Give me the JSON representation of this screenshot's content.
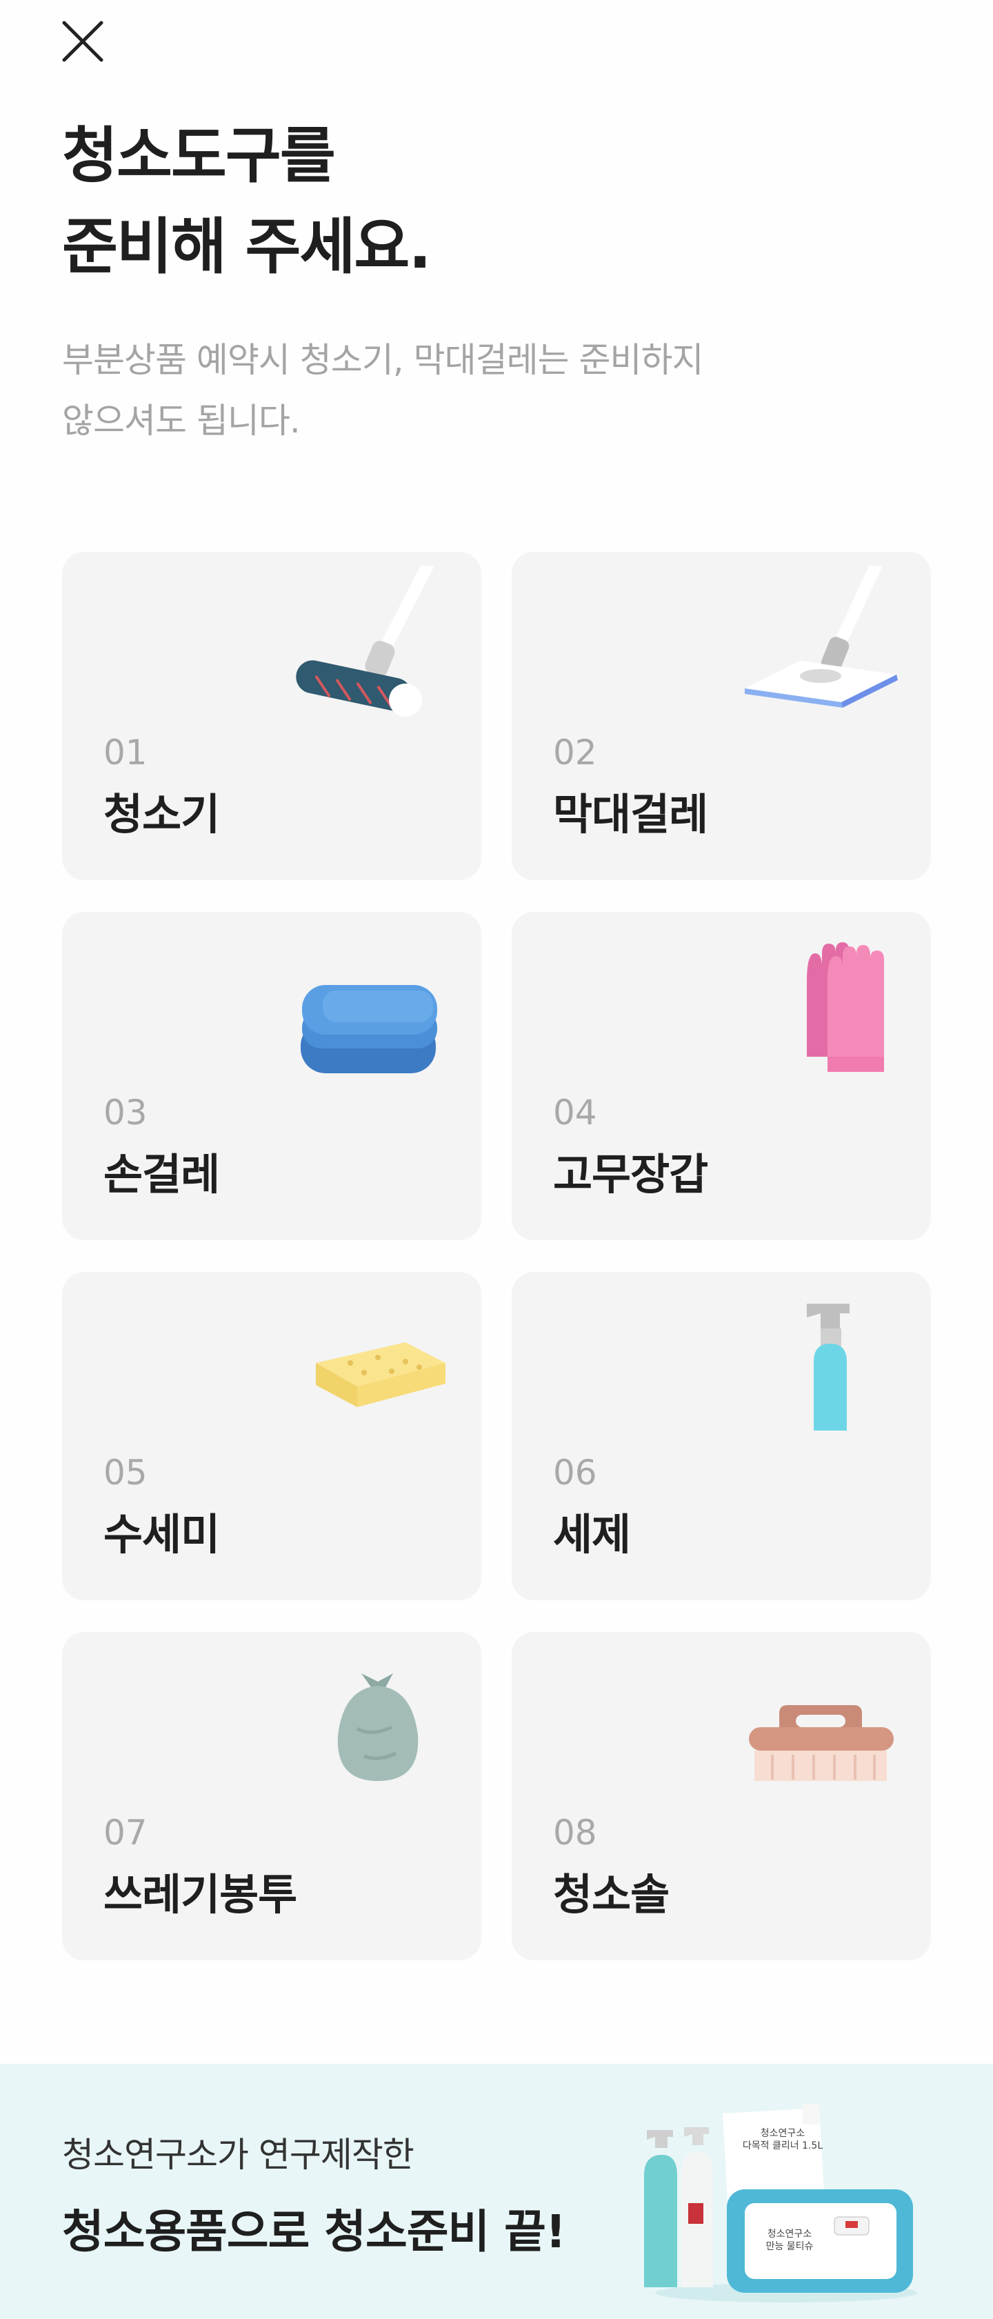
{
  "header": {
    "title_line1": "청소도구를",
    "title_line2": "준비해 주세요.",
    "subtitle_line1": "부분상품 예약시 청소기, 막대걸레는 준비하지",
    "subtitle_line2": "않으셔도 됩니다."
  },
  "tools": [
    {
      "num": "01",
      "name": "청소기",
      "icon": "vacuum-cleaner-icon"
    },
    {
      "num": "02",
      "name": "막대걸레",
      "icon": "floor-mop-icon"
    },
    {
      "num": "03",
      "name": "손걸레",
      "icon": "folded-cloth-icon"
    },
    {
      "num": "04",
      "name": "고무장갑",
      "icon": "rubber-gloves-icon"
    },
    {
      "num": "05",
      "name": "수세미",
      "icon": "sponge-icon"
    },
    {
      "num": "06",
      "name": "세제",
      "icon": "spray-bottle-icon"
    },
    {
      "num": "07",
      "name": "쓰레기봉투",
      "icon": "trash-bag-icon"
    },
    {
      "num": "08",
      "name": "청소솔",
      "icon": "scrub-brush-icon"
    }
  ],
  "banner": {
    "line1": "청소연구소가 연구제작한",
    "line2": "청소용품으로 청소준비 끝!",
    "package1": "청소연구소\n다목적 클리너 1.5L",
    "package2": "청소연구소\n만능 물티슈"
  },
  "colors": {
    "card_bg": "#f4f4f4",
    "banner_bg": "#e8f6f7",
    "number_gray": "#a8a8a8"
  }
}
